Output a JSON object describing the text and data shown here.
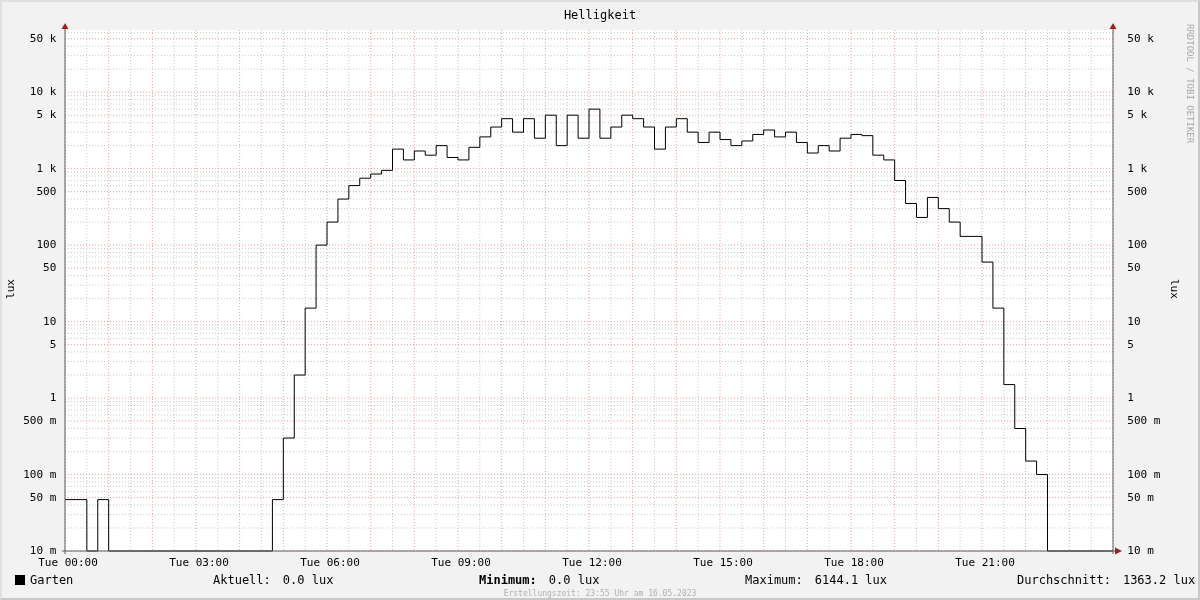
{
  "title": "Helligkeit",
  "credit": "RRDTOOL / TOBI OETIKER",
  "left_axis": {
    "label": "lux",
    "ticks": [
      "50 k",
      "10 k",
      "5 k",
      "1 k",
      "500",
      "100",
      "50",
      "10",
      "5",
      "1",
      "500 m",
      "100 m",
      "50 m",
      "10 m"
    ]
  },
  "right_axis": {
    "label": "lux",
    "ticks": [
      "50 k",
      "10 k",
      "5 k",
      "1 k",
      "500",
      "100",
      "50",
      "10",
      "5",
      "1",
      "500 m",
      "100 m",
      "50 m",
      "10 m"
    ]
  },
  "x_axis": {
    "ticks": [
      "Tue 00:00",
      "Tue 03:00",
      "Tue 06:00",
      "Tue 09:00",
      "Tue 12:00",
      "Tue 15:00",
      "Tue 18:00",
      "Tue 21:00"
    ]
  },
  "legend": {
    "name": "Garten"
  },
  "stats": [
    {
      "label": "Aktuell:",
      "value": "0.0 lux",
      "bold": false
    },
    {
      "label": "Minimum:",
      "value": "0.0 lux",
      "bold": true
    },
    {
      "label": "Maximum:",
      "value": "6144.1 lux",
      "bold": false
    },
    {
      "label": "Durchschnitt:",
      "value": "1363.2 lux",
      "bold": false
    }
  ],
  "footer": "Erstellungszeit: 23:55 Uhr am 16.05.2023"
}
